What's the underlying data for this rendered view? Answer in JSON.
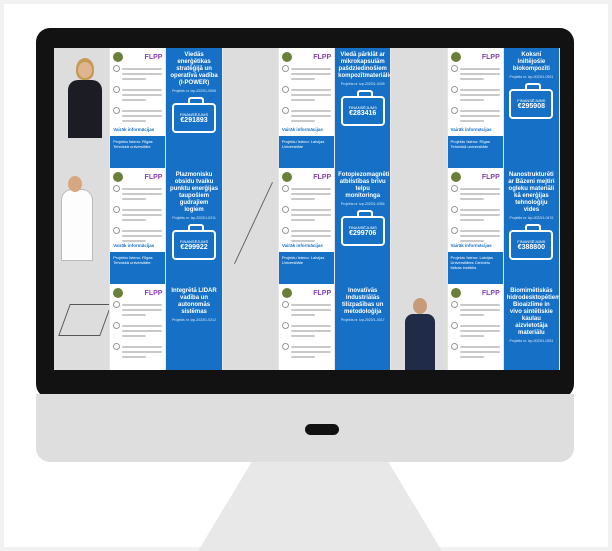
{
  "tiles_row1": [
    {
      "kind": "photo",
      "style": "woman",
      "name": "photo-woman-speaker"
    },
    {
      "kind": "text",
      "foot": "Projektu īsteno:\nRīgas Tehniskā universitāte"
    },
    {
      "kind": "blue",
      "title": "Viedās enerģētikas stratēģijā un operatīvā vadība (I-POWER)",
      "sub": "Projekts nr. lzp-2023/1-0506",
      "amount": "€291893"
    },
    {
      "kind": "photo",
      "style": "pollen",
      "name": "photo-pollen"
    },
    {
      "kind": "text",
      "foot": "Projektu īsteno:\nLatvijas Universitāte"
    },
    {
      "kind": "blue",
      "title": "Viedā pārklāt ar mikrokapsulām pašdziedinošiem kompozītmateriāliem",
      "sub": "Projekts nr. lzp-2023/1-0439",
      "amount": "€283416"
    },
    {
      "kind": "photo",
      "style": "tree",
      "name": "photo-tree"
    },
    {
      "kind": "text",
      "foot": "Projektu īsteno:\nRīgas Tehniskā universitāte"
    },
    {
      "kind": "blue",
      "title": "Koksnī iniltējošie biokompozīti",
      "sub": "Projekts nr. lzp-2023/1-0391",
      "amount": "€295908"
    }
  ],
  "tiles_row2": [
    {
      "kind": "photo",
      "style": "lab",
      "name": "photo-lab-researcher"
    },
    {
      "kind": "text",
      "foot": "Projektu īsteno:\nRīgas Tehniskā universitāte"
    },
    {
      "kind": "blue",
      "title": "Plazmonisku obsidu tvaiku punktu enerģijas taupošiem gudrajiem logiem",
      "sub": "Projekts nr. lzp-2023/1-0211",
      "amount": "€299922"
    },
    {
      "kind": "photo",
      "style": "xray",
      "name": "photo-xray-flower"
    },
    {
      "kind": "text",
      "foot": "Projektu īsteno:\nLatvijas Universitāte"
    },
    {
      "kind": "blue",
      "title": "Fotopiezomagnētiskās atbilstības brīvu telpu monitoringa",
      "sub": "Projekts nr. lzp-2023/1-0354",
      "amount": "€299706"
    },
    {
      "kind": "photo",
      "style": "group",
      "name": "photo-group"
    },
    {
      "kind": "text",
      "foot": "Projektu īsteno:\nLatvijas Universitātes Cietvielu fizikas institūts"
    },
    {
      "kind": "blue",
      "title": "Nanostrukturēti ar Bāzeni mejtiri ogleku materiāli kā enerģijas tehnoloģiju vides",
      "sub": "Projekts nr. lzp-2023/1-0476",
      "amount": "€388800"
    }
  ],
  "tiles_row3": [
    {
      "kind": "photo",
      "style": "robot",
      "name": "photo-robot-diagram"
    },
    {
      "kind": "text",
      "foot": ""
    },
    {
      "kind": "blue",
      "title": "Integrētā LIDAR vadība un autonomās sistēmas",
      "sub": "Projekts nr. lzp-2023/1-0212",
      "amount": ""
    },
    {
      "kind": "photo",
      "style": "road",
      "name": "photo-road"
    },
    {
      "kind": "text",
      "foot": ""
    },
    {
      "kind": "blue",
      "title": "Inovatīvās industriālās tilizpašības un metodoloģija",
      "sub": "Projekts nr. lzp-2023/1-0317",
      "amount": ""
    },
    {
      "kind": "photo",
      "style": "man",
      "name": "photo-man-suit"
    },
    {
      "kind": "text",
      "foot": ""
    },
    {
      "kind": "blue",
      "title": "Biomimētiskās hidrodesktopētiem Bioaizlīme in vivo sintētiskie kaulau aizvietotāja materiālu",
      "sub": "Projekts nr. lzp-2023/1-0281",
      "amount": ""
    }
  ],
  "labels": {
    "brand": "FLPP",
    "finansejums": "FINANSĒJUMS",
    "vairak_info": "Vairāk informācijas"
  }
}
